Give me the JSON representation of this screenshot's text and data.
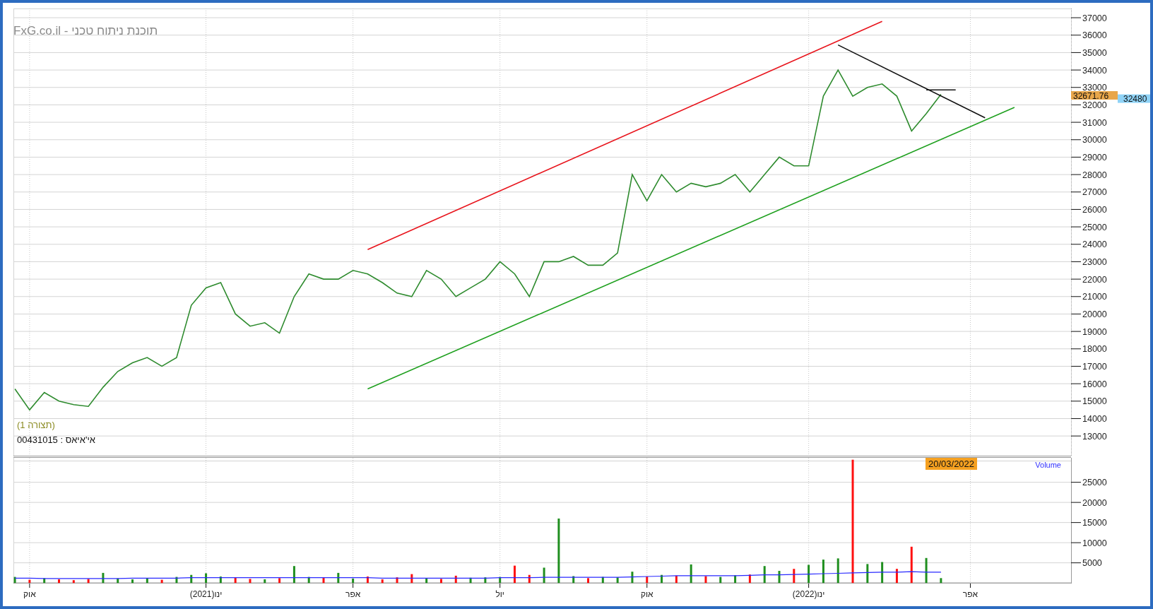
{
  "title": "תוכנת ניתוח טכני - FxG.co.il",
  "price_panel": {
    "layout_label": "(תצורה 1)",
    "security_label": "אי'איאס : 00431015",
    "chart_data": {
      "type": "line",
      "ylim": [
        11870,
        37530
      ],
      "yticks": [
        13000,
        14000,
        15000,
        16000,
        17000,
        18000,
        19000,
        20000,
        21000,
        22000,
        23000,
        24000,
        25000,
        26000,
        27000,
        28000,
        29000,
        30000,
        31000,
        32000,
        33000,
        34000,
        35000,
        36000,
        37000
      ],
      "series": [
        {
          "color": "#2e8b2e",
          "values": [
            15700,
            14500,
            15500,
            15000,
            14800,
            14700,
            15800,
            16700,
            17200,
            17500,
            17000,
            17500,
            20500,
            21500,
            21800,
            20000,
            19300,
            19500,
            18900,
            21000,
            22300,
            22000,
            22000,
            22500,
            22300,
            21800,
            21200,
            21000,
            22500,
            22000,
            21000,
            21500,
            22000,
            23000,
            22300,
            21000,
            23000,
            23000,
            23300,
            22800,
            22800,
            23500,
            28000,
            26500,
            28000,
            27000,
            27500,
            27300,
            27500,
            28000,
            27000,
            28000,
            29000,
            28500,
            28500,
            32500,
            34000,
            32500,
            33000,
            33200,
            32500,
            30500,
            31500,
            32600,
            null,
            null,
            null,
            null,
            null,
            null,
            null,
            null
          ]
        },
        {
          "color": "#e8141c",
          "values": [
            null,
            null,
            null,
            null,
            null,
            null,
            null,
            null,
            null,
            null,
            null,
            null,
            null,
            null,
            null,
            null,
            null,
            null,
            null,
            null,
            null,
            null,
            null,
            null,
            23700,
            null,
            null,
            null,
            null,
            null,
            null,
            null,
            null,
            null,
            null,
            null,
            null,
            null,
            null,
            null,
            null,
            null,
            null,
            null,
            null,
            null,
            null,
            null,
            null,
            null,
            null,
            null,
            null,
            null,
            null,
            null,
            null,
            null,
            null,
            36790,
            null,
            null,
            null,
            null,
            null,
            null,
            null,
            null,
            null,
            null,
            null,
            null
          ]
        },
        {
          "color": "#1fa01f",
          "values": [
            null,
            null,
            null,
            null,
            null,
            null,
            null,
            null,
            null,
            null,
            null,
            null,
            null,
            null,
            null,
            null,
            null,
            null,
            null,
            null,
            null,
            null,
            null,
            null,
            15700,
            null,
            null,
            null,
            null,
            null,
            null,
            null,
            null,
            null,
            null,
            null,
            null,
            null,
            null,
            null,
            null,
            null,
            null,
            null,
            null,
            null,
            null,
            null,
            null,
            null,
            null,
            null,
            null,
            null,
            null,
            null,
            null,
            null,
            null,
            null,
            null,
            null,
            null,
            null,
            null,
            null,
            null,
            null,
            31850,
            null,
            null,
            null
          ]
        },
        {
          "color": "#111111",
          "values": [
            null,
            null,
            null,
            null,
            null,
            null,
            null,
            null,
            null,
            null,
            null,
            null,
            null,
            null,
            null,
            null,
            null,
            null,
            null,
            null,
            null,
            null,
            null,
            null,
            null,
            null,
            null,
            null,
            null,
            null,
            null,
            null,
            null,
            null,
            null,
            null,
            null,
            null,
            null,
            null,
            null,
            null,
            null,
            null,
            null,
            null,
            null,
            null,
            null,
            null,
            null,
            null,
            null,
            null,
            null,
            null,
            35440,
            null,
            null,
            null,
            null,
            null,
            null,
            null,
            null,
            null,
            31260,
            null,
            null,
            null,
            null,
            null
          ]
        },
        {
          "color": "#111111",
          "values": [
            null,
            null,
            null,
            null,
            null,
            null,
            null,
            null,
            null,
            null,
            null,
            null,
            null,
            null,
            null,
            null,
            null,
            null,
            null,
            null,
            null,
            null,
            null,
            null,
            null,
            null,
            null,
            null,
            null,
            null,
            null,
            null,
            null,
            null,
            null,
            null,
            null,
            null,
            null,
            null,
            null,
            null,
            null,
            null,
            null,
            null,
            null,
            null,
            null,
            null,
            null,
            null,
            null,
            null,
            null,
            null,
            null,
            null,
            null,
            null,
            null,
            null,
            32860,
            null,
            32860,
            null,
            null,
            null,
            null,
            null,
            null,
            null
          ]
        }
      ],
      "grid": true
    },
    "price_labels": [
      {
        "text": "32671.76",
        "color": "#e8a64a"
      },
      {
        "text": "32480",
        "color": "#8fd3f7"
      }
    ]
  },
  "volume_panel": {
    "label": "Volume",
    "date_label": "20/03/2022",
    "chart_data": {
      "type": "bar",
      "ylim": [
        -150,
        31075
      ],
      "grid": true,
      "categories": [
        null,
        "אוק",
        null,
        null,
        null,
        null,
        null,
        null,
        null,
        null,
        null,
        null,
        null,
        "ינו(2021)",
        null,
        null,
        null,
        null,
        null,
        null,
        null,
        null,
        null,
        "אפר",
        null,
        null,
        null,
        null,
        null,
        null,
        null,
        null,
        null,
        "יול",
        null,
        null,
        null,
        null,
        null,
        null,
        null,
        null,
        null,
        "אוק",
        null,
        null,
        null,
        null,
        null,
        null,
        null,
        null,
        null,
        null,
        "ינו(2022)",
        null,
        null,
        null,
        null,
        null,
        null,
        null,
        null,
        null,
        null,
        "אפר",
        null,
        null,
        null,
        null,
        null,
        null
      ],
      "yticks": [
        5000,
        10000,
        15000,
        20000,
        25000
      ],
      "series": [
        {
          "type": "bar",
          "color": "#1f8f1f",
          "values": [
            1500,
            null,
            1200,
            null,
            null,
            null,
            2500,
            1100,
            900,
            1200,
            null,
            1500,
            2000,
            2400,
            1600,
            null,
            null,
            900,
            null,
            4200,
            1500,
            null,
            2500,
            1100,
            null,
            null,
            null,
            null,
            1200,
            null,
            null,
            1300,
            1400,
            1500,
            null,
            null,
            3800,
            16000,
            1700,
            null,
            1500,
            1400,
            2800,
            null,
            2000,
            null,
            4600,
            null,
            1500,
            1900,
            null,
            4200,
            3000,
            null,
            4500,
            5800,
            6100,
            null,
            4700,
            5200,
            null,
            null,
            6200,
            1200,
            null,
            null,
            null,
            null,
            null,
            null,
            null,
            null
          ]
        },
        {
          "type": "bar",
          "color": "#ff1010",
          "values": [
            null,
            800,
            null,
            900,
            700,
            1000,
            null,
            null,
            null,
            null,
            800,
            null,
            null,
            null,
            null,
            1300,
            1000,
            null,
            1200,
            null,
            null,
            1300,
            null,
            null,
            1600,
            900,
            1400,
            2200,
            null,
            1000,
            1800,
            null,
            null,
            null,
            4300,
            2000,
            null,
            null,
            null,
            1200,
            null,
            null,
            null,
            1600,
            null,
            1800,
            null,
            1700,
            null,
            null,
            2100,
            null,
            null,
            3500,
            null,
            null,
            null,
            30600,
            null,
            null,
            3500,
            9000,
            null,
            null,
            null,
            null,
            null,
            null,
            null,
            null,
            null,
            null
          ]
        },
        {
          "type": "line",
          "color": "#2a2aff",
          "values": [
            1200,
            1200,
            1100,
            1100,
            1100,
            1100,
            1100,
            1100,
            1200,
            1200,
            1200,
            1200,
            1300,
            1300,
            1300,
            1300,
            1300,
            1300,
            1300,
            1300,
            1300,
            1300,
            1300,
            1300,
            1300,
            1200,
            1200,
            1200,
            1200,
            1200,
            1200,
            1200,
            1200,
            1300,
            1300,
            1300,
            1400,
            1400,
            1400,
            1400,
            1400,
            1400,
            1500,
            1600,
            1700,
            1800,
            1800,
            1800,
            1800,
            1800,
            1900,
            2000,
            2000,
            2100,
            2200,
            2300,
            2400,
            2500,
            2600,
            2700,
            2700,
            2800,
            2700,
            2700,
            null,
            null,
            null,
            null,
            null,
            null,
            null,
            null
          ]
        }
      ]
    }
  }
}
